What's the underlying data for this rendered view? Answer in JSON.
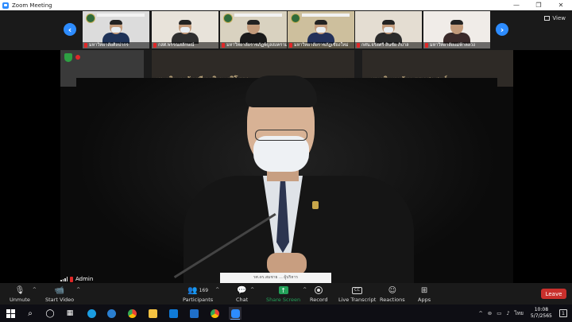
{
  "window": {
    "title": "Zoom Meeting",
    "controls": [
      "—",
      "❐",
      "✕"
    ]
  },
  "gallery": {
    "prev_icon": "chevron-left-icon",
    "next_icon": "chevron-right-icon",
    "view_label": "View",
    "thumbnails": [
      {
        "name": "มหาวิทยาลัยศิลปากร",
        "bg": "#dcdcdc",
        "body": "#1f3358",
        "mask": true
      },
      {
        "name": "กสศ.พรรณสลักษณ์",
        "bg": "#e8e3da",
        "body": "#2f2f2f",
        "mask": true
      },
      {
        "name": "มหาวิทยาลัยราชภัฏพิบูลสงคราม",
        "bg": "#d9d2c0",
        "body": "#1a1a1a",
        "mask": false
      },
      {
        "name": "มหาวิทยาลัยราชภัฏเชียงใหม่",
        "bg": "#cdbf9d",
        "body": "#23315a",
        "mask": true
      },
      {
        "name": "กศน.จรัสศรี สินชัย ภิบาล",
        "bg": "#e4ddd2",
        "body": "#2b2b2b",
        "mask": true
      },
      {
        "name": "มหาวิทยาลัยแม่ฟ้าหลวง",
        "bg": "#f0ece8",
        "body": "#3a2a2a",
        "mask": false
      }
    ]
  },
  "main_video": {
    "screen_texts": [
      "มหาวิทยาลัยศรีนครินทรวิโรฒ",
      "มหาวิทยาลัยธรรมศาสตร์"
    ],
    "participant_name": "Admin",
    "nameplate_text": "รศ.ดร.สมชาย ... ผู้บริหาร"
  },
  "toolbar": {
    "unmute": "Unmute",
    "start_video": "Start Video",
    "participants": "Participants",
    "participants_count": "169",
    "chat": "Chat",
    "share_screen": "Share Screen",
    "record": "Record",
    "live_transcript": "Live Transcript",
    "reactions": "Reactions",
    "apps": "Apps",
    "leave": "Leave"
  },
  "taskbar": {
    "time": "10:08",
    "date": "5/7/2565",
    "lang": "ไทย",
    "notification_count": "1"
  },
  "colors": {
    "accent": "#2d8cff",
    "share": "#23a159",
    "leave": "#c9302c"
  }
}
